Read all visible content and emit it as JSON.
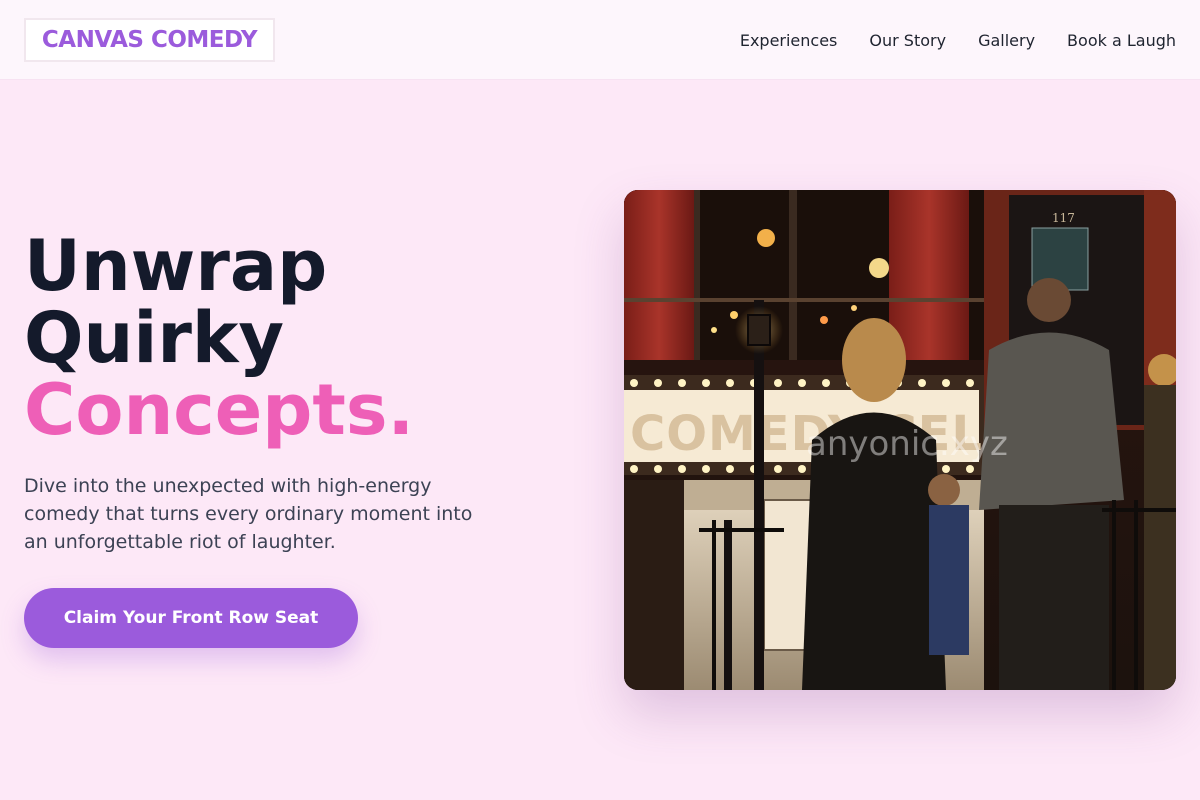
{
  "header": {
    "logo": "CANVAS COMEDY",
    "nav": [
      {
        "label": "Experiences"
      },
      {
        "label": "Our Story"
      },
      {
        "label": "Gallery"
      },
      {
        "label": "Book a Laugh"
      }
    ]
  },
  "hero": {
    "title_line1": "Unwrap",
    "title_line2": "Quirky",
    "title_accent": "Concepts.",
    "description": "Dive into the unexpected with high-energy comedy that turns every ordinary moment into an unforgettable riot of laughter.",
    "cta_label": "Claim Your Front Row Seat"
  },
  "image": {
    "marquee_text": "COMEDY CELLAR",
    "door_number": "117",
    "watermark": "anyonic.xyz"
  },
  "colors": {
    "page_background": "#fde8f7",
    "header_background": "#fdf6fc",
    "brand_purple": "#9b5bdc",
    "accent_pink": "#ee5fb7",
    "heading_dark": "#141a2b",
    "body_text": "#3c4254"
  }
}
